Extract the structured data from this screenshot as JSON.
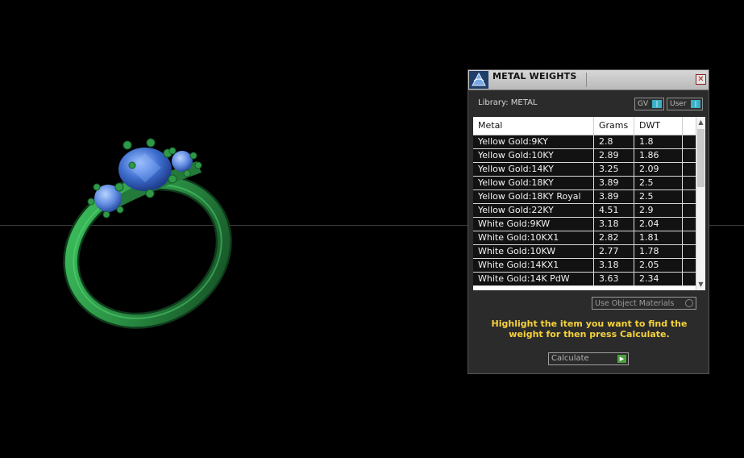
{
  "panel": {
    "title": "METAL WEIGHTS",
    "close_icon": "close-icon",
    "library_label": "Library: METAL",
    "toggles": {
      "gv_label": "GV",
      "user_label": "User"
    },
    "table": {
      "headers": [
        "Metal",
        "Grams",
        "DWT"
      ],
      "rows": [
        {
          "metal": "Yellow Gold:9KY",
          "grams": "2.8",
          "dwt": "1.8"
        },
        {
          "metal": "Yellow Gold:10KY",
          "grams": "2.89",
          "dwt": "1.86"
        },
        {
          "metal": "Yellow Gold:14KY",
          "grams": "3.25",
          "dwt": "2.09"
        },
        {
          "metal": "Yellow Gold:18KY",
          "grams": "3.89",
          "dwt": "2.5"
        },
        {
          "metal": "Yellow Gold:18KY Royal",
          "grams": "3.89",
          "dwt": "2.5"
        },
        {
          "metal": "Yellow Gold:22KY",
          "grams": "4.51",
          "dwt": "2.9"
        },
        {
          "metal": "White Gold:9KW",
          "grams": "3.18",
          "dwt": "2.04"
        },
        {
          "metal": "White Gold:10KX1",
          "grams": "2.82",
          "dwt": "1.81"
        },
        {
          "metal": "White Gold:10KW",
          "grams": "2.77",
          "dwt": "1.78"
        },
        {
          "metal": "White Gold:14KX1",
          "grams": "3.18",
          "dwt": "2.05"
        },
        {
          "metal": "White Gold:14K PdW",
          "grams": "3.63",
          "dwt": "2.34"
        }
      ]
    },
    "use_object_materials_label": "Use Object Materials",
    "hint": "Highlight the item you want to find the weight for then press Calculate.",
    "calculate_label": "Calculate"
  },
  "colors": {
    "background": "#000000",
    "ring_metal": "#2f9e4b",
    "gem": "#3f6fd0",
    "hint_text": "#f6d23b",
    "toggle_accent": "#3bb1c6",
    "calc_arrow": "#4ea03f"
  }
}
